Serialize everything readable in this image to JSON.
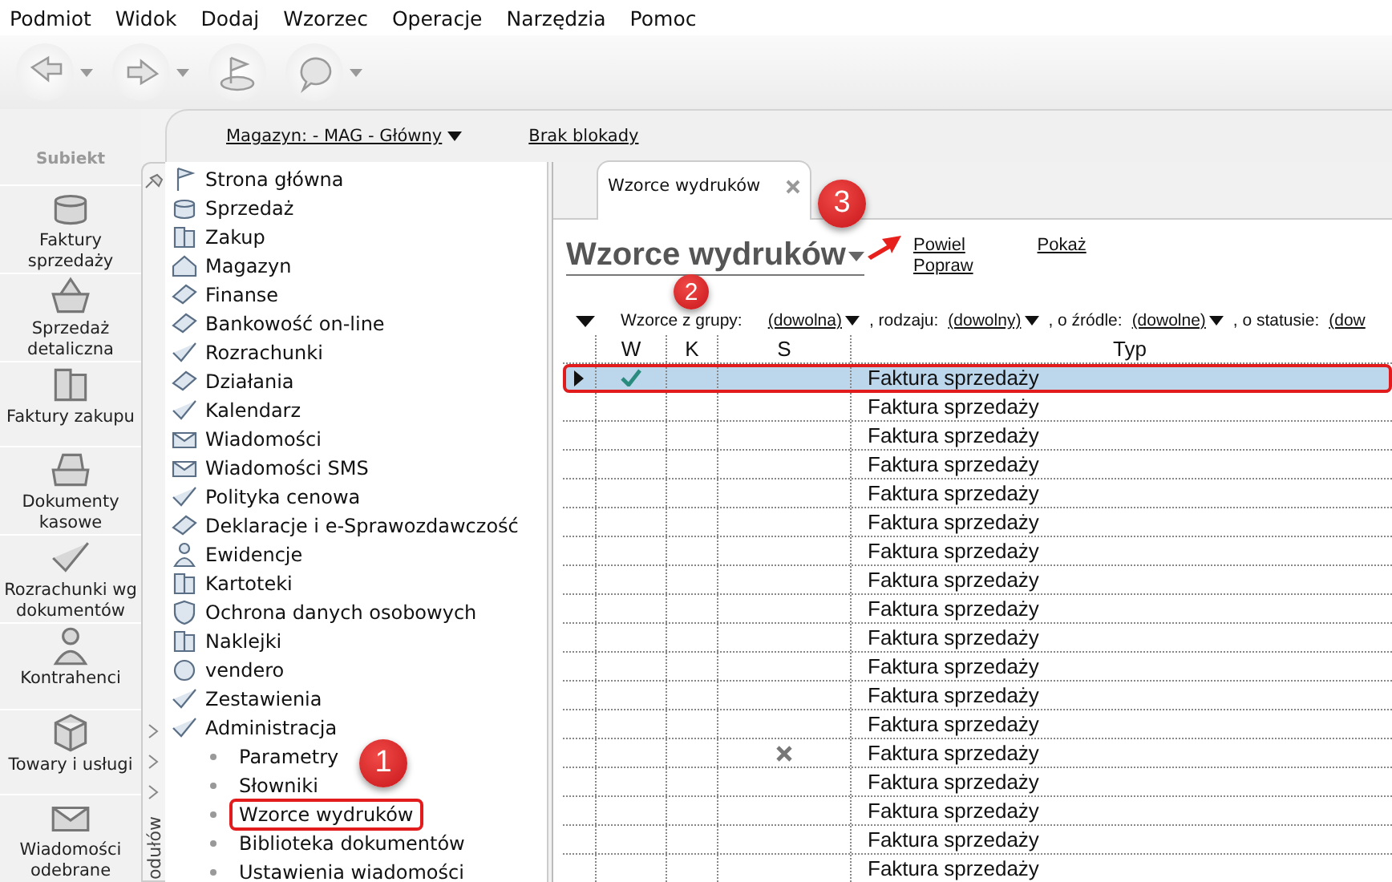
{
  "menu": [
    "Podmiot",
    "Widok",
    "Dodaj",
    "Wzorzec",
    "Operacje",
    "Narzędzia",
    "Pomoc"
  ],
  "toolbar": [
    {
      "kind": "back",
      "dropdown": true
    },
    {
      "kind": "forward",
      "dropdown": true
    },
    {
      "kind": "home",
      "dropdown": false
    },
    {
      "kind": "help",
      "dropdown": true
    }
  ],
  "logo": {
    "text": "Subiekt"
  },
  "nav": [
    {
      "label": "Faktury sprzedaży",
      "kind": "coins"
    },
    {
      "label": "Sprzedaż detaliczna",
      "kind": "basket"
    },
    {
      "label": "Faktury zakupu",
      "kind": "books"
    },
    {
      "label": "Dokumenty kasowe",
      "kind": "register"
    },
    {
      "label": "Rozrachunki wg dokumentów",
      "kind": "check"
    },
    {
      "label": "Kontrahenci",
      "kind": "person"
    },
    {
      "label": "Towary i usługi",
      "kind": "box"
    },
    {
      "label": "Wiadomości odebrane",
      "kind": "mail"
    }
  ],
  "topbar": {
    "warehouse": "Magazyn: - MAG - Główny",
    "lock": "Brak blokady"
  },
  "modules": {
    "side_label": "odułów",
    "items": [
      {
        "label": "Strona główna",
        "kind": "flag"
      },
      {
        "label": "Sprzedaż",
        "kind": "coins"
      },
      {
        "label": "Zakup",
        "kind": "books"
      },
      {
        "label": "Magazyn",
        "kind": "house"
      },
      {
        "label": "Finanse",
        "kind": "card"
      },
      {
        "label": "Bankowość on-line",
        "kind": "card"
      },
      {
        "label": "Rozrachunki",
        "kind": "check"
      },
      {
        "label": "Działania",
        "kind": "card"
      },
      {
        "label": "Kalendarz",
        "kind": "check"
      },
      {
        "label": "Wiadomości",
        "kind": "mail"
      },
      {
        "label": "Wiadomości SMS",
        "kind": "mail"
      },
      {
        "label": "Polityka cenowa",
        "kind": "check"
      },
      {
        "label": "Deklaracje i e-Sprawozdawczość",
        "kind": "card"
      },
      {
        "label": "Ewidencje",
        "kind": "person"
      },
      {
        "label": "Kartoteki",
        "kind": "books"
      },
      {
        "label": "Ochrona danych osobowych",
        "kind": "shield"
      },
      {
        "label": "Naklejki",
        "kind": "books"
      },
      {
        "label": "vendero",
        "kind": "ring"
      },
      {
        "label": "Zestawienia",
        "kind": "check"
      },
      {
        "label": "Administracja",
        "kind": "check",
        "children": [
          {
            "label": "Parametry",
            "selected": false
          },
          {
            "label": "Słowniki",
            "selected": false
          },
          {
            "label": "Wzorce wydruków",
            "selected": true
          },
          {
            "label": "Biblioteka dokumentów",
            "selected": false
          },
          {
            "label": "Ustawienia wiadomości",
            "selected": false
          }
        ]
      }
    ]
  },
  "tab": {
    "label": "Wzorce wydruków"
  },
  "title": "Wzorce wydruków",
  "actions": [
    [
      "Powiel",
      "Popraw"
    ],
    [
      "Pokaż"
    ]
  ],
  "filter": {
    "lead": "Wzorce z grupy:",
    "parts": [
      {
        "value": "(dowolna)",
        "after": ", rodzaju:"
      },
      {
        "value": "(dowolny)",
        "after": ", o źródle:"
      },
      {
        "value": "(dowolne)",
        "after": ", o statusie:"
      },
      {
        "value": "(dow"
      }
    ]
  },
  "table": {
    "columns": [
      "W",
      "K",
      "S",
      "Typ"
    ],
    "rows": [
      {
        "w": true,
        "s": false,
        "typ": "Faktura sprzedaży",
        "selected": true
      },
      {
        "w": false,
        "s": false,
        "typ": "Faktura sprzedaży",
        "selected": false
      },
      {
        "w": false,
        "s": false,
        "typ": "Faktura sprzedaży",
        "selected": false
      },
      {
        "w": false,
        "s": false,
        "typ": "Faktura sprzedaży",
        "selected": false
      },
      {
        "w": false,
        "s": false,
        "typ": "Faktura sprzedaży",
        "selected": false
      },
      {
        "w": false,
        "s": false,
        "typ": "Faktura sprzedaży",
        "selected": false
      },
      {
        "w": false,
        "s": false,
        "typ": "Faktura sprzedaży",
        "selected": false
      },
      {
        "w": false,
        "s": false,
        "typ": "Faktura sprzedaży",
        "selected": false
      },
      {
        "w": false,
        "s": false,
        "typ": "Faktura sprzedaży",
        "selected": false
      },
      {
        "w": false,
        "s": false,
        "typ": "Faktura sprzedaży",
        "selected": false
      },
      {
        "w": false,
        "s": false,
        "typ": "Faktura sprzedaży",
        "selected": false
      },
      {
        "w": false,
        "s": false,
        "typ": "Faktura sprzedaży",
        "selected": false
      },
      {
        "w": false,
        "s": false,
        "typ": "Faktura sprzedaży",
        "selected": false
      },
      {
        "w": false,
        "s": true,
        "typ": "Faktura sprzedaży",
        "selected": false
      },
      {
        "w": false,
        "s": false,
        "typ": "Faktura sprzedaży",
        "selected": false
      },
      {
        "w": false,
        "s": false,
        "typ": "Faktura sprzedaży",
        "selected": false
      },
      {
        "w": false,
        "s": false,
        "typ": "Faktura sprzedaży",
        "selected": false
      },
      {
        "w": false,
        "s": false,
        "typ": "Faktura sprzedaży",
        "selected": false
      }
    ]
  },
  "callouts": [
    "1",
    "2",
    "3"
  ]
}
